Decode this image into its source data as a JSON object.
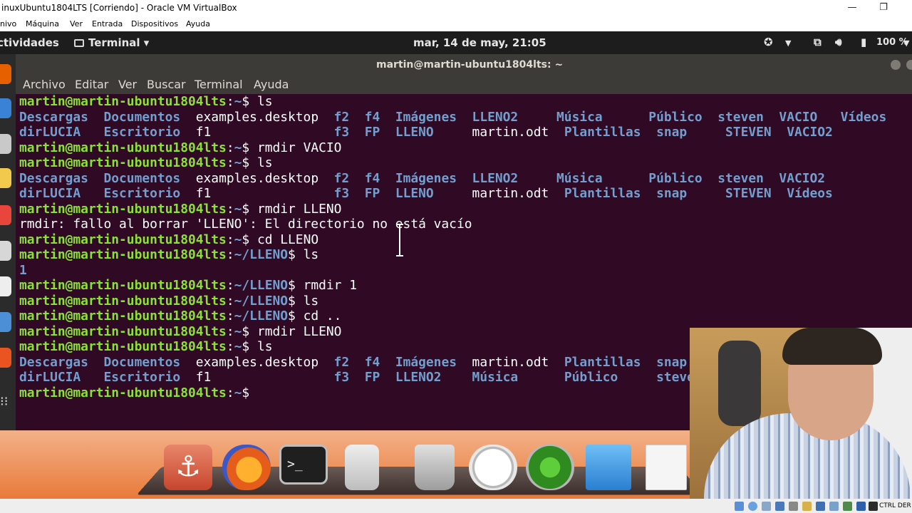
{
  "host": {
    "title": "inuxUbuntu1804LTS [Corriendo] - Oracle VM VirtualBox",
    "menu": [
      "nivo",
      "Máquina",
      "Ver",
      "Entrada",
      "Dispositivos",
      "Ayuda"
    ],
    "host_key": "CTRL DER"
  },
  "topbar": {
    "activities": "ctividades",
    "app_name": "Terminal",
    "app_arrow": "▾",
    "clock": "mar, 14 de may, 21:05",
    "battery": "100 %"
  },
  "terminal": {
    "title": "martin@martin-ubuntu1804lts: ~",
    "menu": [
      "Archivo",
      "Editar",
      "Ver",
      "Buscar",
      "Terminal",
      "Ayuda"
    ],
    "lines": [
      [
        {
          "t": "prompt",
          "user": "martin@martin-ubuntu1804lts",
          "path": "~",
          "cmd": " ls"
        }
      ],
      [
        {
          "t": "d",
          "v": "Descargas  "
        },
        {
          "t": "d",
          "v": "Documentos  "
        },
        {
          "t": "f",
          "v": "examples.desktop  "
        },
        {
          "t": "d",
          "v": "f2  "
        },
        {
          "t": "d",
          "v": "f4  "
        },
        {
          "t": "d",
          "v": "Imágenes  "
        },
        {
          "t": "d",
          "v": "LLENO2     "
        },
        {
          "t": "d",
          "v": "Música      "
        },
        {
          "t": "d",
          "v": "Público  "
        },
        {
          "t": "d",
          "v": "steven  "
        },
        {
          "t": "d",
          "v": "VACIO   "
        },
        {
          "t": "d",
          "v": "Vídeos"
        }
      ],
      [
        {
          "t": "d",
          "v": "dirLUCIA   "
        },
        {
          "t": "d",
          "v": "Escritorio  "
        },
        {
          "t": "f",
          "v": "f1                "
        },
        {
          "t": "d",
          "v": "f3  "
        },
        {
          "t": "d",
          "v": "FP  "
        },
        {
          "t": "d",
          "v": "LLENO     "
        },
        {
          "t": "f",
          "v": "martin.odt  "
        },
        {
          "t": "d",
          "v": "Plantillas  "
        },
        {
          "t": "d",
          "v": "snap     "
        },
        {
          "t": "d",
          "v": "STEVEN  "
        },
        {
          "t": "d",
          "v": "VACIO2"
        }
      ],
      [
        {
          "t": "prompt",
          "user": "martin@martin-ubuntu1804lts",
          "path": "~",
          "cmd": " rmdir VACIO"
        }
      ],
      [
        {
          "t": "prompt",
          "user": "martin@martin-ubuntu1804lts",
          "path": "~",
          "cmd": " ls"
        }
      ],
      [
        {
          "t": "d",
          "v": "Descargas  "
        },
        {
          "t": "d",
          "v": "Documentos  "
        },
        {
          "t": "f",
          "v": "examples.desktop  "
        },
        {
          "t": "d",
          "v": "f2  "
        },
        {
          "t": "d",
          "v": "f4  "
        },
        {
          "t": "d",
          "v": "Imágenes  "
        },
        {
          "t": "d",
          "v": "LLENO2     "
        },
        {
          "t": "d",
          "v": "Música      "
        },
        {
          "t": "d",
          "v": "Público  "
        },
        {
          "t": "d",
          "v": "steven  "
        },
        {
          "t": "d",
          "v": "VACIO2"
        }
      ],
      [
        {
          "t": "d",
          "v": "dirLUCIA   "
        },
        {
          "t": "d",
          "v": "Escritorio  "
        },
        {
          "t": "f",
          "v": "f1                "
        },
        {
          "t": "d",
          "v": "f3  "
        },
        {
          "t": "d",
          "v": "FP  "
        },
        {
          "t": "d",
          "v": "LLENO     "
        },
        {
          "t": "f",
          "v": "martin.odt  "
        },
        {
          "t": "d",
          "v": "Plantillas  "
        },
        {
          "t": "d",
          "v": "snap     "
        },
        {
          "t": "d",
          "v": "STEVEN  "
        },
        {
          "t": "d",
          "v": "Vídeos"
        }
      ],
      [
        {
          "t": "prompt",
          "user": "martin@martin-ubuntu1804lts",
          "path": "~",
          "cmd": " rmdir LLENO"
        }
      ],
      [
        {
          "t": "f",
          "v": "rmdir: fallo al borrar 'LLENO': El directorio no está vacío"
        }
      ],
      [
        {
          "t": "prompt",
          "user": "martin@martin-ubuntu1804lts",
          "path": "~",
          "cmd": " cd LLENO"
        }
      ],
      [
        {
          "t": "prompt",
          "user": "martin@martin-ubuntu1804lts",
          "path": "~/LLENO",
          "cmd": " ls"
        }
      ],
      [
        {
          "t": "d",
          "v": "1"
        }
      ],
      [
        {
          "t": "prompt",
          "user": "martin@martin-ubuntu1804lts",
          "path": "~/LLENO",
          "cmd": " rmdir 1"
        }
      ],
      [
        {
          "t": "prompt",
          "user": "martin@martin-ubuntu1804lts",
          "path": "~/LLENO",
          "cmd": " ls"
        }
      ],
      [
        {
          "t": "prompt",
          "user": "martin@martin-ubuntu1804lts",
          "path": "~/LLENO",
          "cmd": " cd .."
        }
      ],
      [
        {
          "t": "prompt",
          "user": "martin@martin-ubuntu1804lts",
          "path": "~",
          "cmd": " rmdir LLENO"
        }
      ],
      [
        {
          "t": "prompt",
          "user": "martin@martin-ubuntu1804lts",
          "path": "~",
          "cmd": " ls"
        }
      ],
      [
        {
          "t": "d",
          "v": "Descargas  "
        },
        {
          "t": "d",
          "v": "Documentos  "
        },
        {
          "t": "f",
          "v": "examples.desktop  "
        },
        {
          "t": "d",
          "v": "f2  "
        },
        {
          "t": "d",
          "v": "f4  "
        },
        {
          "t": "d",
          "v": "Imágenes  "
        },
        {
          "t": "f",
          "v": "martin.odt  "
        },
        {
          "t": "d",
          "v": "Plantillas  "
        },
        {
          "t": "d",
          "v": "snap"
        }
      ],
      [
        {
          "t": "d",
          "v": "dirLUCIA   "
        },
        {
          "t": "d",
          "v": "Escritorio  "
        },
        {
          "t": "f",
          "v": "f1                "
        },
        {
          "t": "d",
          "v": "f3  "
        },
        {
          "t": "d",
          "v": "FP  "
        },
        {
          "t": "d",
          "v": "LLENO2    "
        },
        {
          "t": "d",
          "v": "Música      "
        },
        {
          "t": "d",
          "v": "Público     "
        },
        {
          "t": "d",
          "v": "steve"
        }
      ],
      [
        {
          "t": "prompt",
          "user": "martin@martin-ubuntu1804lts",
          "path": "~",
          "cmd": " "
        }
      ]
    ]
  },
  "colors": {
    "terminal_bg": "#300a24",
    "prompt_user": "#8ae234",
    "prompt_path": "#729fcf",
    "directory": "#729fcf",
    "desktop_orange": "#e06a2f"
  },
  "dock_icons": [
    "anchor-icon",
    "firefox-icon",
    "terminal-icon",
    "speaker-icon",
    "trash-icon",
    "clock-icon",
    "radar-icon",
    "finder-icon",
    "document-icon"
  ]
}
